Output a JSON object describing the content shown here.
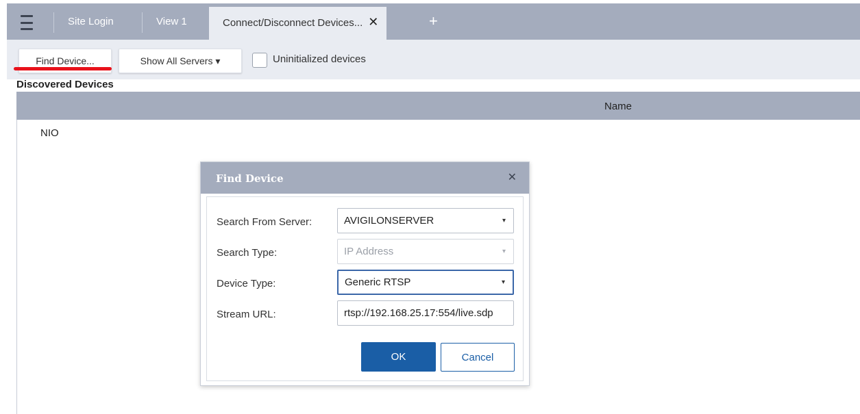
{
  "tabs": {
    "items": [
      {
        "label": "Site Login"
      },
      {
        "label": "View 1"
      },
      {
        "label": "Connect/Disconnect Devices..."
      }
    ],
    "close_glyph": "✕",
    "add_glyph": "+",
    "menu_icon": "hamburger-menu-icon"
  },
  "toolbar": {
    "find_device_label": "Find Device...",
    "show_servers_label": "Show All Servers ▾",
    "uninitialized_label": "Uninitialized devices",
    "uninitialized_checked": false
  },
  "discovered": {
    "title": "Discovered Devices",
    "column_name": "Name",
    "rows": [
      {
        "name": "NIO"
      }
    ]
  },
  "dialog": {
    "title": "Find Device",
    "close_glyph": "✕",
    "fields": [
      {
        "label": "Search From Server:",
        "value": "AVIGILONSERVER"
      },
      {
        "label": "Search Type:",
        "value": "IP Address"
      },
      {
        "label": "Device Type:",
        "value": "Generic RTSP"
      },
      {
        "label": "Stream URL:",
        "value": "rtsp://192.168.25.17:554/live.sdp"
      }
    ],
    "caret_glyph": "▾",
    "ok_label": "OK",
    "cancel_label": "Cancel"
  },
  "colors": {
    "header_gray": "#a4acbd",
    "toolbar_bg": "#e9ecf2",
    "primary_blue": "#1a5ea6",
    "highlight_red": "#e8121b"
  }
}
